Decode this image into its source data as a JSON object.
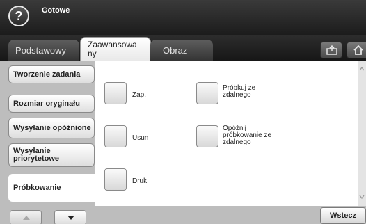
{
  "header": {
    "help_symbol": "?",
    "status": "Gotowe"
  },
  "tabs": [
    {
      "label": "Podstawowy"
    },
    {
      "label": "Zaawansowa\nny"
    },
    {
      "label": "Obraz"
    }
  ],
  "tab_icons": [
    "scan-to-box-icon",
    "home-icon"
  ],
  "sidebar": {
    "items": [
      {
        "label": "Tworzenie zadania"
      },
      {
        "label": "Rozmiar oryginału"
      },
      {
        "label": "Wysyłanie opóźnione"
      },
      {
        "label": "Wysyłanie priorytetowe"
      },
      {
        "label": "Próbkowanie"
      }
    ]
  },
  "options": {
    "zap": "Zap,",
    "usun": "Usun",
    "druk": "Druk",
    "probkuj": "Próbkuj ze zdalnego",
    "opoznij": "Opóźnij próbkowanie ze zdalnego"
  },
  "footer": {
    "back_label": "Wstecz"
  }
}
